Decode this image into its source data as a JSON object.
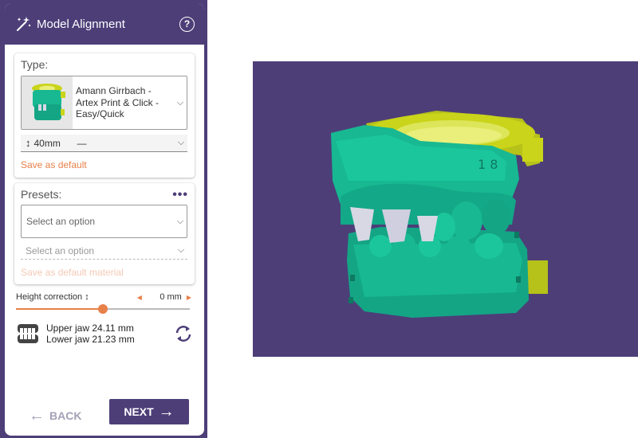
{
  "panel": {
    "title": "Model Alignment",
    "help_icon": "help-icon",
    "type": {
      "label": "Type:",
      "model_name": "Amann Girrbach - Artex Print & Click - Easy/Quick",
      "height_value": "40mm",
      "height_extra": "—",
      "save_default": "Save as default"
    },
    "presets": {
      "label": "Presets:",
      "menu_icon": "more-options-icon",
      "select_placeholder": "Select an option",
      "sub_select_placeholder": "Select an option",
      "save_default_material": "Save as default material"
    },
    "height_correction": {
      "label": "Height correction",
      "value": "0 mm",
      "slider_fraction": 0.5
    },
    "jaw": {
      "upper": "Upper jaw 24.11 mm",
      "lower": "Lower jaw 21.23 mm"
    },
    "buttons": {
      "back": "BACK",
      "next": "NEXT"
    }
  },
  "colors": {
    "brand": "#4d3e78",
    "accent": "#e8804a",
    "model_teal": "#17b892",
    "articulator_yellow": "#c9d41a",
    "teeth_grey": "#d8d8e4"
  }
}
